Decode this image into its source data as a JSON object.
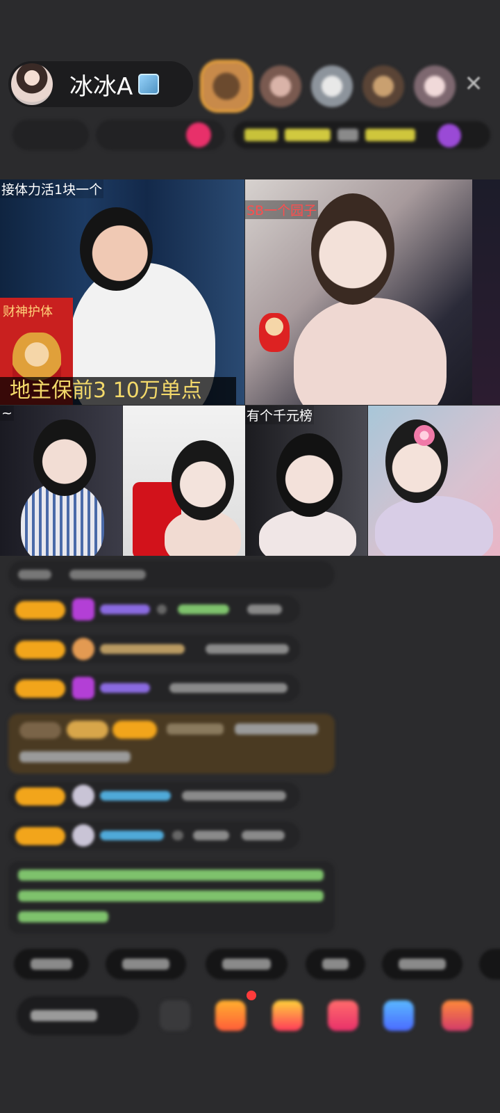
{
  "host": {
    "name": "冰冰A",
    "badge_icon": "ice-cube-icon"
  },
  "viewers": {
    "count": 5,
    "colors": [
      "#c88a4a",
      "#b08880",
      "#9aa0a8",
      "#8a7060",
      "#a89098"
    ]
  },
  "close_icon": "close-icon",
  "tiles": [
    {
      "caption": "接体力活1块一个",
      "banner": "地主保前3  10万单点",
      "card_text": "财神护体"
    },
    {
      "caption": "SB一个园子"
    },
    {
      "caption": "~"
    },
    {
      "caption": ""
    },
    {
      "caption": "有个千元榜"
    },
    {
      "caption": ""
    }
  ],
  "accent_colors": {
    "level_badge": "#f2a51b",
    "diamond": "#b33fd6",
    "name_purple": "#8a6ae0",
    "name_green": "#7ec26c",
    "name_blue": "#4fa9d8"
  }
}
